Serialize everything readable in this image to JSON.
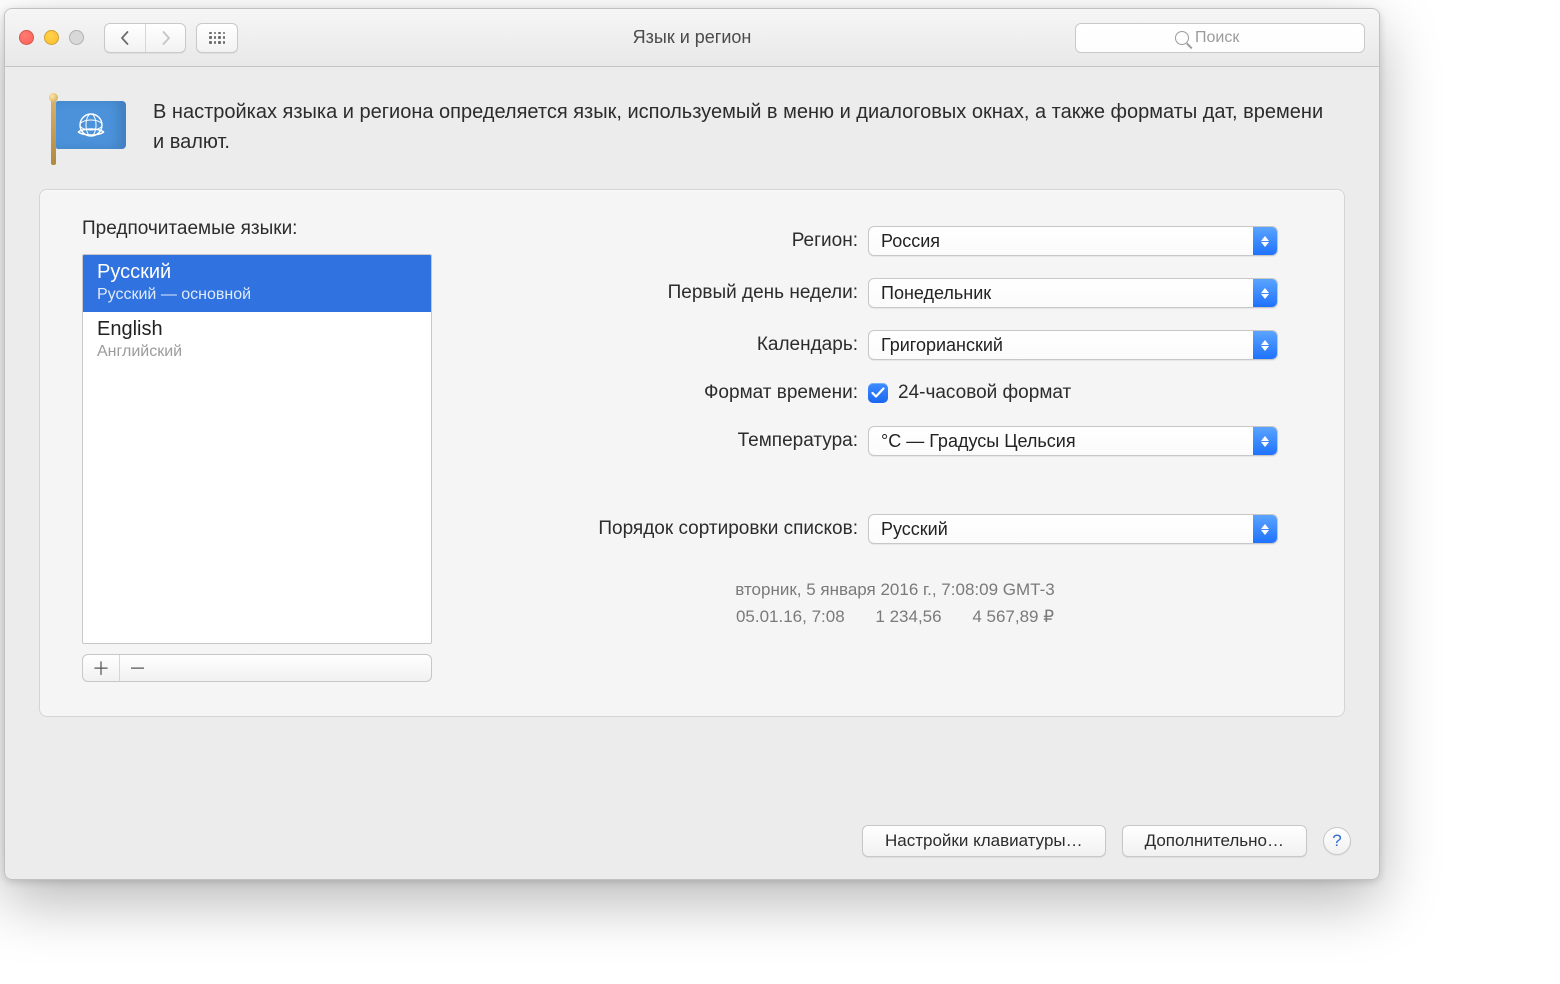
{
  "window": {
    "title": "Язык и регион"
  },
  "search": {
    "placeholder": "Поиск"
  },
  "description": "В настройках языка и региона определяется язык, используемый в меню и диалоговых окнах, а также форматы дат, времени и валют.",
  "left": {
    "heading": "Предпочитаемые языки:",
    "languages": [
      {
        "name": "Русский",
        "sub": "Русский — основной",
        "selected": true
      },
      {
        "name": "English",
        "sub": "Английский",
        "selected": false
      }
    ]
  },
  "rows": {
    "region": {
      "label": "Регион:",
      "value": "Россия"
    },
    "firstDay": {
      "label": "Первый день недели:",
      "value": "Понедельник"
    },
    "calendar": {
      "label": "Календарь:",
      "value": "Григорианский"
    },
    "timeFormat": {
      "label": "Формат времени:",
      "checkbox_label": "24-часовой формат",
      "checked": true
    },
    "temperature": {
      "label": "Температура:",
      "value": "°C — Градусы Цельсия"
    },
    "sortOrder": {
      "label": "Порядок сортировки списков:",
      "value": "Русский"
    }
  },
  "preview": {
    "line1": "вторник, 5 января 2016 г., 7:08:09 GMT-3",
    "short_date": "05.01.16, 7:08",
    "number": "1 234,56",
    "currency": "4 567,89 ₽"
  },
  "footer": {
    "keyboard": "Настройки клавиатуры…",
    "advanced": "Дополнительно…"
  }
}
